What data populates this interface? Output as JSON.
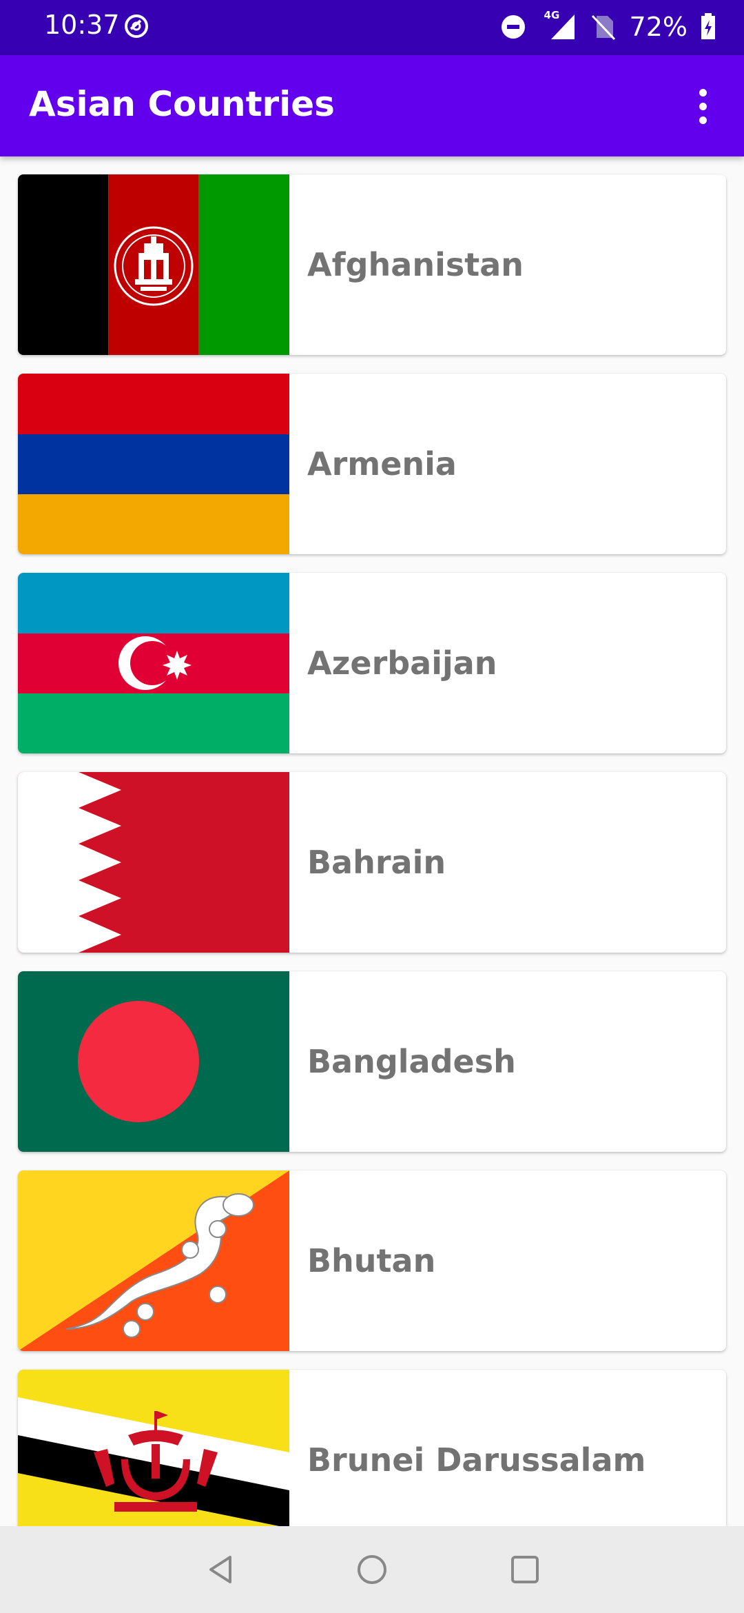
{
  "status_bar": {
    "time": "10:37",
    "network": "4G",
    "battery": "72%"
  },
  "app_bar": {
    "title": "Asian Countries",
    "menu_icon": "more-vert-icon"
  },
  "countries": [
    {
      "name": "Afghanistan",
      "flag_icon": "afghanistan-flag"
    },
    {
      "name": "Armenia",
      "flag_icon": "armenia-flag"
    },
    {
      "name": "Azerbaijan",
      "flag_icon": "azerbaijan-flag"
    },
    {
      "name": "Bahrain",
      "flag_icon": "bahrain-flag"
    },
    {
      "name": "Bangladesh",
      "flag_icon": "bangladesh-flag"
    },
    {
      "name": "Bhutan",
      "flag_icon": "bhutan-flag"
    },
    {
      "name": "Brunei Darussalam",
      "flag_icon": "brunei-flag"
    }
  ],
  "nav_bar": {
    "back_icon": "back-triangle-icon",
    "home_icon": "home-circle-icon",
    "recents_icon": "recents-square-icon"
  },
  "colors": {
    "status_bar": "#3700b3",
    "app_bar": "#6200ee",
    "item_text": "#737373"
  }
}
